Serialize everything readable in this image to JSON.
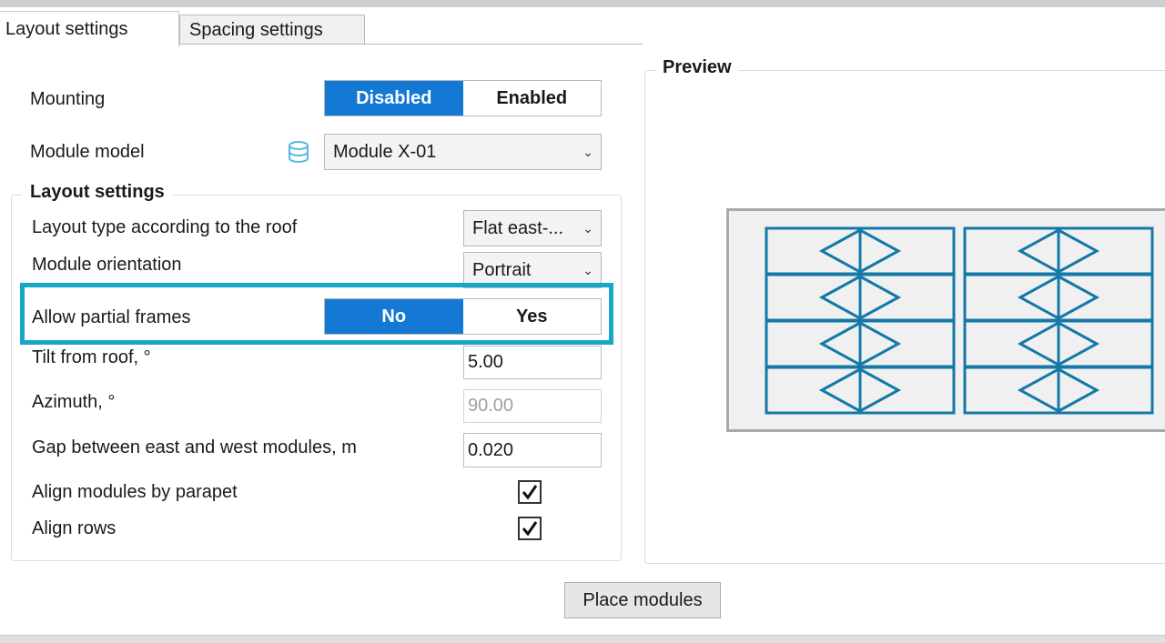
{
  "tabs": [
    {
      "label": "Layout settings",
      "active": true
    },
    {
      "label": "Spacing settings",
      "active": false
    }
  ],
  "mounting": {
    "label": "Mounting",
    "options": [
      "Disabled",
      "Enabled"
    ],
    "selected": "Disabled"
  },
  "module_model": {
    "label": "Module model",
    "value": "Module X-01",
    "icon": "database-icon"
  },
  "layout_group": {
    "title": "Layout settings",
    "layout_type": {
      "label": "Layout type according to the roof",
      "value": "Flat east-..."
    },
    "module_orientation": {
      "label": "Module orientation",
      "value": "Portrait"
    },
    "allow_partial_frames": {
      "label": "Allow partial frames",
      "options": [
        "No",
        "Yes"
      ],
      "selected": "No"
    },
    "tilt": {
      "label": "Tilt from roof, °",
      "value": "5.00"
    },
    "azimuth": {
      "label": "Azimuth, °",
      "value": "90.00",
      "disabled": true
    },
    "gap": {
      "label": "Gap between east and west modules,  m",
      "value": "0.020"
    },
    "align_parapet": {
      "label": "Align modules by parapet",
      "checked": true
    },
    "align_rows": {
      "label": "Align rows",
      "checked": true
    }
  },
  "preview": {
    "title": "Preview",
    "module_rows": 4,
    "module_columns": 2
  },
  "place_button": "Place modules",
  "colors": {
    "accent": "#1479d4",
    "highlight": "#17a7c9",
    "module_stroke": "#1478a8"
  }
}
